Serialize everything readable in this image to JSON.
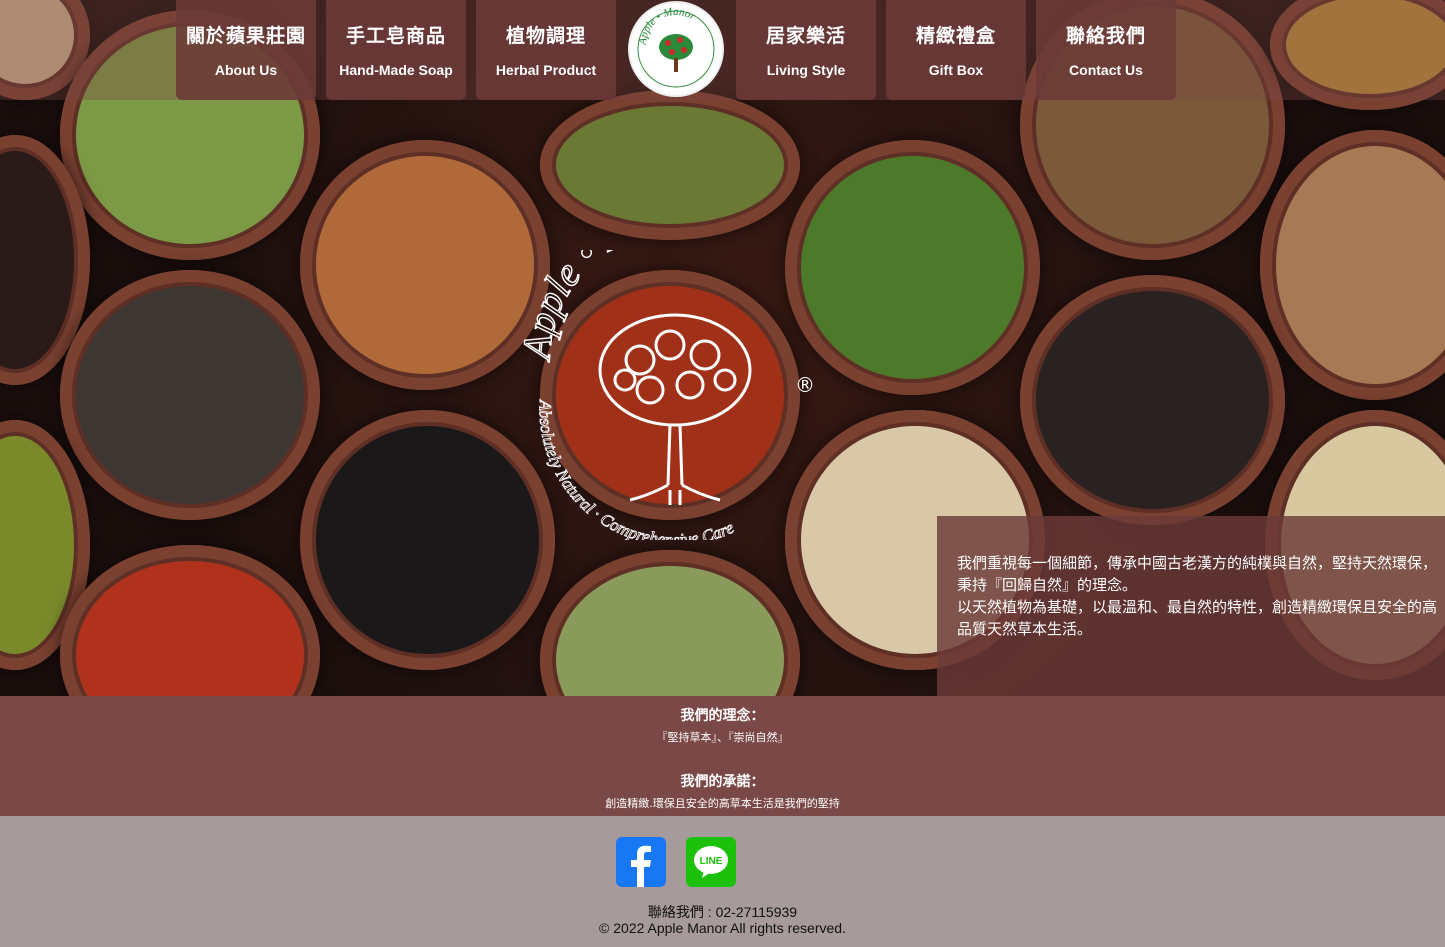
{
  "nav": {
    "items": [
      {
        "zh": "關於蘋果莊園",
        "en": "About Us"
      },
      {
        "zh": "手工皂商品",
        "en": "Hand-Made Soap"
      },
      {
        "zh": "植物調理",
        "en": "Herbal Product"
      },
      {
        "zh": "居家樂活",
        "en": "Living Style"
      },
      {
        "zh": "精緻禮盒",
        "en": "Gift Box"
      },
      {
        "zh": "聯絡我們",
        "en": "Contact Us"
      }
    ],
    "logo_text": "Apple • Manor"
  },
  "hero": {
    "watermark_brand": "Apple • Manor",
    "watermark_tagline": "Absolutely Natural · Comprehensive Care",
    "registered": "®"
  },
  "intro": {
    "line1": "我們重視每一個細節，傳承中國古老漢方的純樸與自然，堅持天然環保，秉持『回歸自然』的理念。",
    "line2": "以天然植物為基礎，以最溫和、最自然的特性，創造精緻環保且安全的高品質天然草本生活。"
  },
  "philosophy": {
    "title": "我們的理念：",
    "text": "『堅持草本』、『崇尚自然』"
  },
  "promise": {
    "title": "我們的承諾：",
    "text": "創造精緻.環保且安全的高草本生活是我們的堅持"
  },
  "footer": {
    "contact": "聯絡我們 : 02-27115939",
    "copyright": "© 2022 Apple Manor All rights reserved."
  },
  "colors": {
    "brand": "#7a4846",
    "footer_bg": "#a69a9a",
    "facebook": "#1877f2",
    "line": "#1dc10b"
  },
  "icons": [
    "facebook-icon",
    "line-icon"
  ]
}
